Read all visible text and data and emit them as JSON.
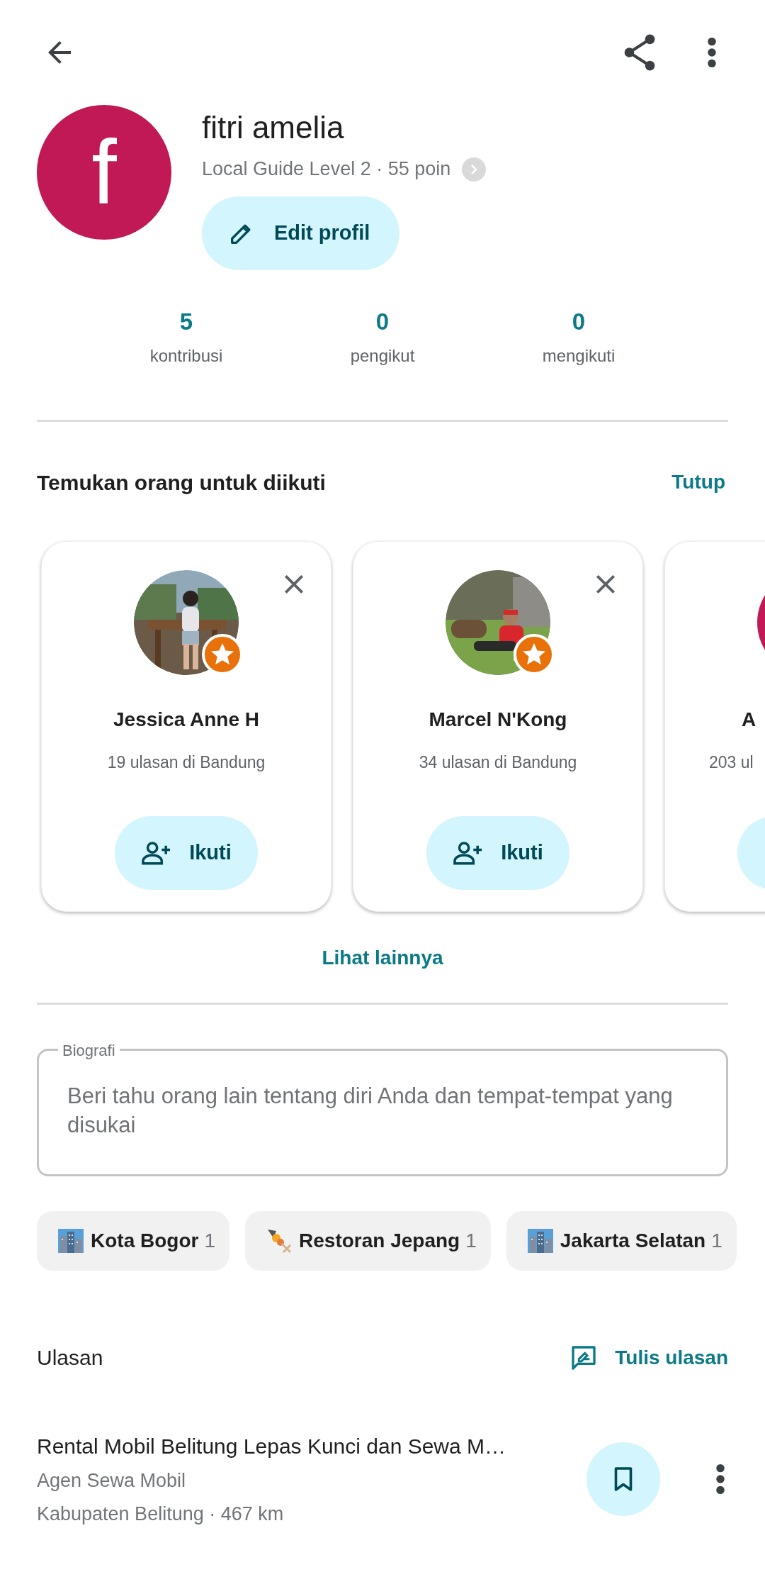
{
  "profile": {
    "avatar_letter": "f",
    "name": "fitri amelia",
    "level_text": "Local Guide Level 2 · 55 poin",
    "edit_button": "Edit profil"
  },
  "stats": [
    {
      "value": "5",
      "label": "kontribusi"
    },
    {
      "value": "0",
      "label": "pengikut"
    },
    {
      "value": "0",
      "label": "mengikuti"
    }
  ],
  "suggestions": {
    "title": "Temukan orang untuk diikuti",
    "close_label": "Tutup",
    "more_link": "Lihat lainnya",
    "people": [
      {
        "name": "Jessica Anne H",
        "subtitle": "19 ulasan di Bandung",
        "follow_label": "Ikuti",
        "guide_badge": true
      },
      {
        "name": "Marcel N'Kong",
        "subtitle": "34 ulasan di Bandung",
        "follow_label": "Ikuti",
        "guide_badge": true
      },
      {
        "kind": "letter",
        "name": "A",
        "subtitle": "203 ul"
      }
    ]
  },
  "bio": {
    "label": "Biografi",
    "placeholder": "Beri tahu orang lain tentang diri Anda dan tempat-tempat yang disukai"
  },
  "chips": [
    {
      "kind": "city",
      "label": "Kota Bogor",
      "count": "1"
    },
    {
      "kind": "food",
      "label": "Restoran Jepang",
      "count": "1"
    },
    {
      "kind": "city",
      "label": "Jakarta Selatan",
      "count": "1"
    }
  ],
  "reviews": {
    "title": "Ulasan",
    "write_label": "Tulis ulasan",
    "items": [
      {
        "name": "Rental Mobil Belitung Lepas Kunci dan Sewa M…",
        "category": "Agen Sewa Mobil",
        "location": "Kabupaten Belitung · 467 km"
      }
    ]
  }
}
